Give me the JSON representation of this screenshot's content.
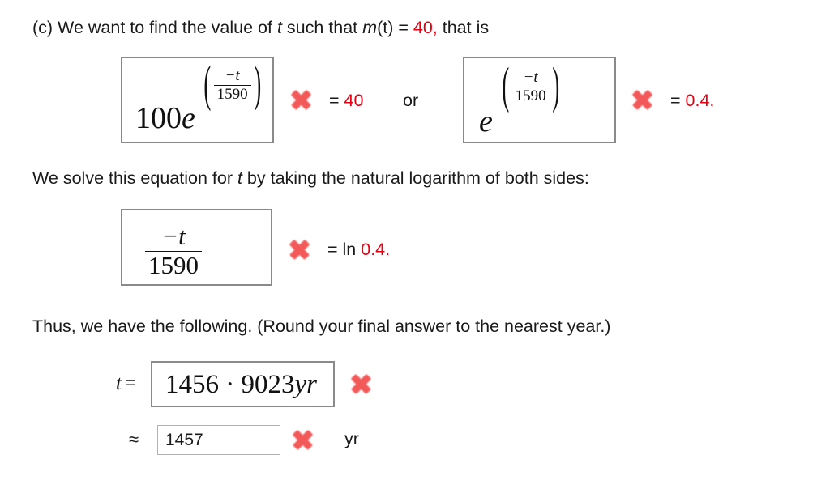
{
  "page": {
    "background": "#ffffff",
    "accent_red": "#e60012",
    "mark_red": "#f25a5a",
    "box_border": "#8a8a8a",
    "input_border": "#b3b3b3"
  },
  "line1": {
    "part_a": "(c) We want to find the value of ",
    "var_t": "t",
    "part_b": " such that ",
    "func": "m",
    "func_args": "(t)",
    "equals": " = ",
    "value": "40,",
    "part_c": "  that is"
  },
  "equation_row1": {
    "box1": {
      "coefficient": "100",
      "base": "e",
      "paren_open": "(",
      "paren_close": ")",
      "exponent_numerator": "−t",
      "exponent_denominator": "1590"
    },
    "mark1": "incorrect-x",
    "relation1_operator": "=",
    "relation1_value": "40",
    "conjunction": "or",
    "box2": {
      "base": "e",
      "paren_open": "(",
      "paren_close": ")",
      "exponent_numerator": "−t",
      "exponent_denominator": "1590"
    },
    "mark2": "incorrect-x",
    "relation2_operator": "=",
    "relation2_value": "0.4."
  },
  "line2": {
    "part_a": "We solve this equation for ",
    "var_t": "t",
    "part_b": " by taking the natural logarithm of both sides:"
  },
  "equation_row2": {
    "box3": {
      "numerator": "−t",
      "denominator": "1590"
    },
    "mark3": "incorrect-x",
    "relation_operator": "= ln ",
    "relation_value": "0.4."
  },
  "line3": {
    "text": "Thus, we have the following. (Round your final answer to the nearest year.)"
  },
  "answer_row1": {
    "label_var": "t",
    "label_equals": "=",
    "value": "1456 · 9023",
    "value_unit": "yr",
    "mark": "incorrect-x"
  },
  "answer_row2": {
    "approx_symbol": "≈",
    "value": "1457",
    "mark": "incorrect-x",
    "unit": "yr"
  }
}
